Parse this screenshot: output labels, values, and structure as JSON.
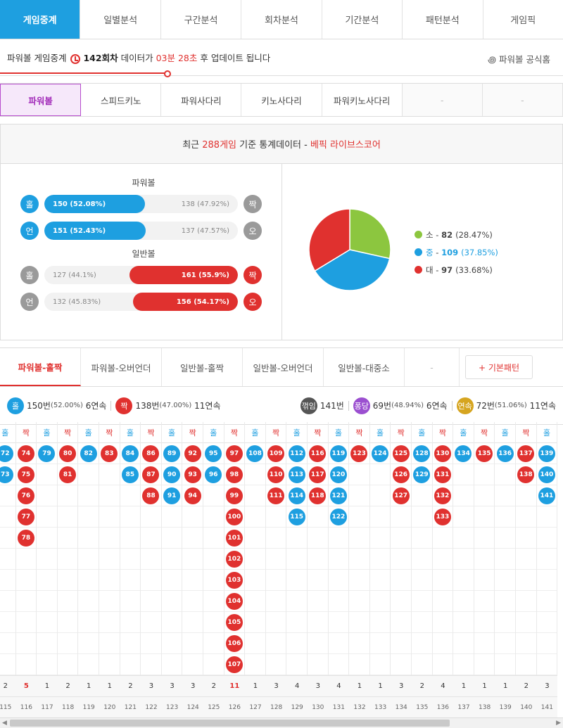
{
  "colors": {
    "blue": "#1e9fe0",
    "red": "#e0312f",
    "gray": "#9a9a9a",
    "green": "#8cc63f",
    "purple": "#9b4fd0",
    "gold": "#d6a520",
    "dark": "#555555"
  },
  "top_tabs": [
    "게임중계",
    "일별분석",
    "구간분석",
    "회차분석",
    "기간분석",
    "패턴분석",
    "게임픽"
  ],
  "info": {
    "prefix": "파워볼 게임중계",
    "round": "142회차",
    "mid": "데이터가",
    "time": "03분 28초",
    "suffix": "후 업데이트 됩니다",
    "official": "파워볼 공식홈"
  },
  "sub_tabs": [
    "파워볼",
    "스피드키노",
    "파워사다리",
    "키노사다리",
    "파워키노사다리",
    "-",
    "-"
  ],
  "stats": {
    "head_a": "최근",
    "head_count": "288게임",
    "head_b": "기준 통계데이터 -",
    "head_c": "베픽 라이브스코어",
    "group_power": "파워볼",
    "group_normal": "일반볼",
    "rows": [
      {
        "left": "홀",
        "right": "짝",
        "win": "150 (52.08%)",
        "lose": "138 (47.92%)",
        "pct": 52.08,
        "side": "left",
        "color": "#1e9fe0"
      },
      {
        "left": "언",
        "right": "오",
        "win": "151 (52.43%)",
        "lose": "137 (47.57%)",
        "pct": 52.43,
        "side": "left",
        "color": "#1e9fe0"
      },
      {
        "left": "홀",
        "right": "짝",
        "win": "161 (55.9%)",
        "lose": "127 (44.1%)",
        "pct": 55.9,
        "side": "right",
        "color": "#e0312f"
      },
      {
        "left": "언",
        "right": "오",
        "win": "156 (54.17%)",
        "lose": "132 (45.83%)",
        "pct": 54.17,
        "side": "right",
        "color": "#e0312f"
      }
    ],
    "pie": [
      {
        "label": "소",
        "value": "82",
        "pct": "(28.47%)",
        "p": 28.47,
        "color": "#8cc63f"
      },
      {
        "label": "중",
        "value": "109",
        "pct": "(37.85%)",
        "p": 37.85,
        "color": "#1e9fe0"
      },
      {
        "label": "대",
        "value": "97",
        "pct": "(33.68%)",
        "p": 33.68,
        "color": "#e0312f"
      }
    ]
  },
  "pattern_tabs": [
    "파워볼-홀짝",
    "파워볼-오버언더",
    "일반볼-홀짝",
    "일반볼-오버언더",
    "일반볼-대중소",
    "-"
  ],
  "pattern_button": "+ 기본패턴",
  "summary": {
    "odd": "홀",
    "odd_count": "150번",
    "odd_pct": "(52.00%)",
    "odd_streak": "6연속",
    "even": "짝",
    "even_count": "138번",
    "even_pct": "(47.00%)",
    "even_streak": "11연속",
    "flip": "꺾임",
    "flip_count": "141번",
    "pong": "퐁당",
    "pong_count": "69번",
    "pong_pct": "(48.94%)",
    "pong_streak": "6연속",
    "run": "연속",
    "run_count": "72번",
    "run_pct": "(51.06%)",
    "run_streak": "11연속"
  },
  "grid": [
    {
      "h": "홀",
      "n": [
        72,
        73
      ],
      "count": "2",
      "id": "115"
    },
    {
      "h": "짝",
      "n": [
        74,
        75,
        76,
        77,
        78
      ],
      "count": "5",
      "id": "116"
    },
    {
      "h": "홀",
      "n": [
        79
      ],
      "count": "1",
      "id": "117"
    },
    {
      "h": "짝",
      "n": [
        80,
        81
      ],
      "count": "2",
      "id": "118"
    },
    {
      "h": "홀",
      "n": [
        82
      ],
      "count": "1",
      "id": "119"
    },
    {
      "h": "짝",
      "n": [
        83
      ],
      "count": "1",
      "id": "120"
    },
    {
      "h": "홀",
      "n": [
        84,
        85
      ],
      "count": "2",
      "id": "121"
    },
    {
      "h": "짝",
      "n": [
        86,
        87,
        88
      ],
      "count": "3",
      "id": "122"
    },
    {
      "h": "홀",
      "n": [
        89,
        90,
        91
      ],
      "count": "3",
      "id": "123"
    },
    {
      "h": "짝",
      "n": [
        92,
        93,
        94
      ],
      "count": "3",
      "id": "124"
    },
    {
      "h": "홀",
      "n": [
        95,
        96
      ],
      "count": "2",
      "id": "125"
    },
    {
      "h": "짝",
      "n": [
        97,
        98,
        99,
        100,
        101,
        102,
        103,
        104,
        105,
        106,
        107
      ],
      "count": "11",
      "id": "126"
    },
    {
      "h": "홀",
      "n": [
        108
      ],
      "count": "1",
      "id": "127"
    },
    {
      "h": "짝",
      "n": [
        109,
        110,
        111
      ],
      "count": "3",
      "id": "128"
    },
    {
      "h": "홀",
      "n": [
        112,
        113,
        114,
        115
      ],
      "count": "4",
      "id": "129"
    },
    {
      "h": "짝",
      "n": [
        116,
        117,
        118
      ],
      "count": "3",
      "id": "130"
    },
    {
      "h": "홀",
      "n": [
        119,
        120,
        121,
        122
      ],
      "count": "4",
      "id": "131"
    },
    {
      "h": "짝",
      "n": [
        123
      ],
      "count": "1",
      "id": "132"
    },
    {
      "h": "홀",
      "n": [
        124
      ],
      "count": "1",
      "id": "133"
    },
    {
      "h": "짝",
      "n": [
        125,
        126,
        127
      ],
      "count": "3",
      "id": "134"
    },
    {
      "h": "홀",
      "n": [
        128,
        129
      ],
      "count": "2",
      "id": "135"
    },
    {
      "h": "짝",
      "n": [
        130,
        131,
        132,
        133
      ],
      "count": "4",
      "id": "136"
    },
    {
      "h": "홀",
      "n": [
        134
      ],
      "count": "1",
      "id": "137"
    },
    {
      "h": "짝",
      "n": [
        135
      ],
      "count": "1",
      "id": "138"
    },
    {
      "h": "홀",
      "n": [
        136
      ],
      "count": "1",
      "id": "139"
    },
    {
      "h": "짝",
      "n": [
        137,
        138
      ],
      "count": "2",
      "id": "140"
    },
    {
      "h": "홀",
      "n": [
        139,
        140,
        141
      ],
      "count": "3",
      "id": "141"
    }
  ]
}
